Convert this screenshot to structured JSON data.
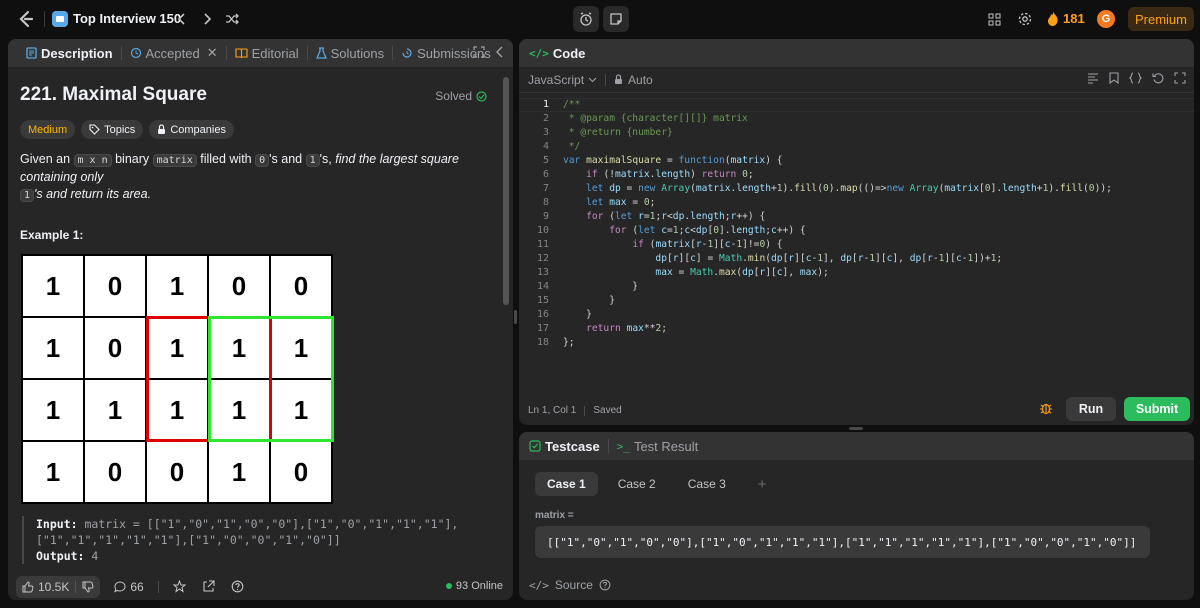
{
  "topbar": {
    "list_title": "Top Interview 150",
    "streak_count": "181",
    "avatar_initial": "G",
    "premium_label": "Premium"
  },
  "description_panel": {
    "tabs": [
      {
        "label": "Description",
        "icon": "document-icon",
        "active": true
      },
      {
        "label": "Accepted",
        "icon": "history-icon"
      },
      {
        "label": "Editorial",
        "icon": "book-icon"
      },
      {
        "label": "Solutions",
        "icon": "flask-icon"
      },
      {
        "label": "Submissions",
        "icon": "clock-icon"
      }
    ],
    "problem_title": "221. Maximal Square",
    "solved_label": "Solved",
    "difficulty": "Medium",
    "topics_label": "Topics",
    "companies_label": "Companies",
    "desc_parts": {
      "p1": "Given an ",
      "code1": "m x n",
      "p2": " binary ",
      "code2": "matrix",
      "p3": " filled with ",
      "code3": "0",
      "p4": "'s and ",
      "code4": "1",
      "p5": "'s, ",
      "p6": "find the largest square containing only ",
      "code5": "1",
      "p7": "'s and return its area."
    },
    "example_title": "Example 1:",
    "matrix": [
      [
        "1",
        "0",
        "1",
        "0",
        "0"
      ],
      [
        "1",
        "0",
        "1",
        "1",
        "1"
      ],
      [
        "1",
        "1",
        "1",
        "1",
        "1"
      ],
      [
        "1",
        "0",
        "0",
        "1",
        "0"
      ]
    ],
    "input_label": "Input:",
    "input_value": " matrix = [[\"1\",\"0\",\"1\",\"0\",\"0\"],[\"1\",\"0\",\"1\",\"1\",\"1\"],",
    "input_value_cont": "[\"1\",\"1\",\"1\",\"1\",\"1\"],[\"1\",\"0\",\"0\",\"1\",\"0\"]]",
    "output_label": "Output:",
    "output_value": " 4",
    "likes": "10.5K",
    "comments": "66",
    "online": "93 Online"
  },
  "code_panel": {
    "title": "Code",
    "language": "JavaScript",
    "mode": "Auto",
    "cursor_pos": "Ln 1, Col 1",
    "save_status": "Saved",
    "run_label": "Run",
    "submit_label": "Submit",
    "line_numbers": [
      "1",
      "2",
      "3",
      "4",
      "5",
      "6",
      "7",
      "8",
      "9",
      "10",
      "11",
      "12",
      "13",
      "14",
      "15",
      "16",
      "17",
      "18"
    ]
  },
  "testcase_panel": {
    "tab_testcase": "Testcase",
    "tab_result": "Test Result",
    "cases": [
      "Case 1",
      "Case 2",
      "Case 3"
    ],
    "add_label": "+",
    "var_name": "matrix =",
    "var_value": "[[\"1\",\"0\",\"1\",\"0\",\"0\"],[\"1\",\"0\",\"1\",\"1\",\"1\"],[\"1\",\"1\",\"1\",\"1\",\"1\"],[\"1\",\"0\",\"0\",\"1\",\"0\"]]",
    "source_label": "Source"
  },
  "colors": {
    "accent_orange": "#ffa116",
    "submit_green": "#2cbb5d",
    "medium": "#ffb800",
    "red_square": "#e10000",
    "green_square": "#2ee62e"
  }
}
